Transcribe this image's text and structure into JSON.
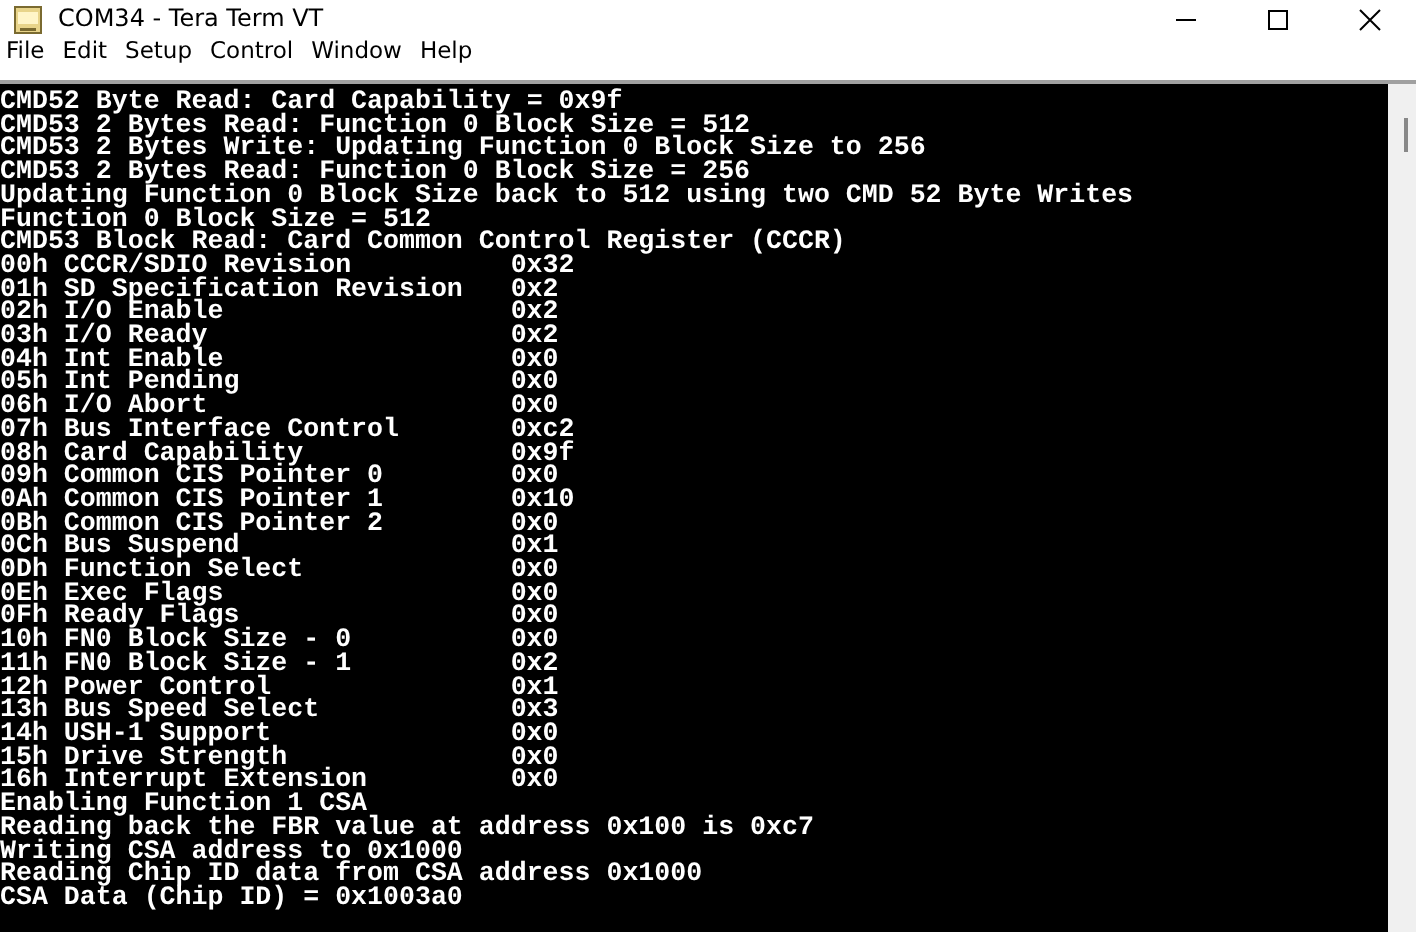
{
  "window": {
    "title": "COM34 - Tera Term VT"
  },
  "menu": [
    "File",
    "Edit",
    "Setup",
    "Control",
    "Window",
    "Help"
  ],
  "terminal": {
    "lines": [
      {
        "kind": "text",
        "text": "CMD52 Byte Read: Card Capability = 0x9f"
      },
      {
        "kind": "text",
        "text": "CMD53 2 Bytes Read: Function 0 Block Size = 512"
      },
      {
        "kind": "text",
        "text": "CMD53 2 Bytes Write: Updating Function 0 Block Size to 256"
      },
      {
        "kind": "text",
        "text": "CMD53 2 Bytes Read: Function 0 Block Size = 256"
      },
      {
        "kind": "text",
        "text": "Updating Function 0 Block Size back to 512 using two CMD 52 Byte Writes"
      },
      {
        "kind": "text",
        "text": "Function 0 Block Size = 512"
      },
      {
        "kind": "text",
        "text": "CMD53 Block Read: Card Common Control Register (CCCR)"
      },
      {
        "kind": "register",
        "field": "00h CCCR/SDIO Revision",
        "value": "0x32"
      },
      {
        "kind": "register",
        "field": "01h SD Specification Revision",
        "value": "0x2"
      },
      {
        "kind": "register",
        "field": "02h I/O Enable",
        "value": "0x2"
      },
      {
        "kind": "register",
        "field": "03h I/O Ready",
        "value": "0x2"
      },
      {
        "kind": "register",
        "field": "04h Int Enable",
        "value": "0x0"
      },
      {
        "kind": "register",
        "field": "05h Int Pending",
        "value": "0x0"
      },
      {
        "kind": "register",
        "field": "06h I/O Abort",
        "value": "0x0"
      },
      {
        "kind": "register",
        "field": "07h Bus Interface Control",
        "value": "0xc2"
      },
      {
        "kind": "register",
        "field": "08h Card Capability",
        "value": "0x9f"
      },
      {
        "kind": "register",
        "field": "09h Common CIS Pointer 0",
        "value": "0x0"
      },
      {
        "kind": "register",
        "field": "0Ah Common CIS Pointer 1",
        "value": "0x10"
      },
      {
        "kind": "register",
        "field": "0Bh Common CIS Pointer 2",
        "value": "0x0"
      },
      {
        "kind": "register",
        "field": "0Ch Bus Suspend",
        "value": "0x1"
      },
      {
        "kind": "register",
        "field": "0Dh Function Select",
        "value": "0x0"
      },
      {
        "kind": "register",
        "field": "0Eh Exec Flags",
        "value": "0x0"
      },
      {
        "kind": "register",
        "field": "0Fh Ready Flags",
        "value": "0x0"
      },
      {
        "kind": "register",
        "field": "10h FN0 Block Size - 0",
        "value": "0x0"
      },
      {
        "kind": "register",
        "field": "11h FN0 Block Size - 1",
        "value": "0x2"
      },
      {
        "kind": "register",
        "field": "12h Power Control",
        "value": "0x1"
      },
      {
        "kind": "register",
        "field": "13h Bus Speed Select",
        "value": "0x3"
      },
      {
        "kind": "register",
        "field": "14h USH-1 Support",
        "value": "0x0"
      },
      {
        "kind": "register",
        "field": "15h Drive Strength",
        "value": "0x0"
      },
      {
        "kind": "register",
        "field": "16h Interrupt Extension",
        "value": "0x0"
      },
      {
        "kind": "text",
        "text": "Enabling Function 1 CSA"
      },
      {
        "kind": "text",
        "text": "Reading back the FBR value at address 0x100 is 0xc7"
      },
      {
        "kind": "text",
        "text": "Writing CSA address to 0x1000"
      },
      {
        "kind": "text",
        "text": "Reading Chip ID data from CSA address 0x1000"
      },
      {
        "kind": "text",
        "text": "CSA Data (Chip ID) = 0x1003a0"
      }
    ]
  }
}
